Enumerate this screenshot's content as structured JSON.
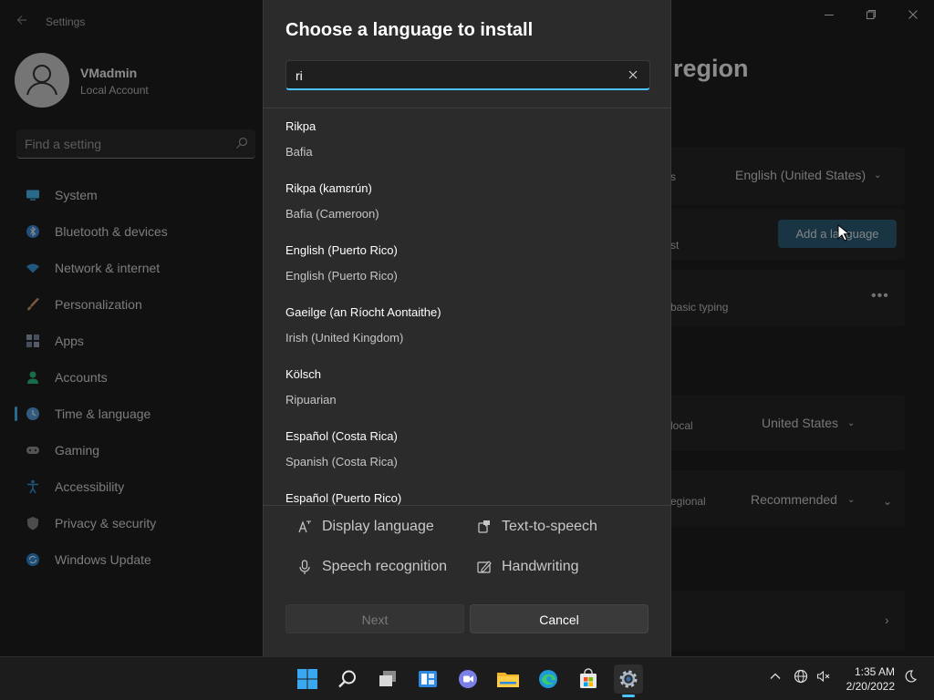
{
  "window": {
    "app_title": "Settings",
    "user": {
      "name": "VMadmin",
      "account_type": "Local Account"
    },
    "search": {
      "placeholder": "Find a setting"
    }
  },
  "sidebar": {
    "items": [
      {
        "label": "System",
        "icon": "monitor-icon",
        "color": "#4cc2ff"
      },
      {
        "label": "Bluetooth & devices",
        "icon": "bluetooth-icon",
        "color": "#3b8ee0"
      },
      {
        "label": "Network & internet",
        "icon": "wifi-icon",
        "color": "#3aa0e8"
      },
      {
        "label": "Personalization",
        "icon": "brush-icon",
        "color": "#e0a070"
      },
      {
        "label": "Apps",
        "icon": "apps-icon",
        "color": "#9aa8c0"
      },
      {
        "label": "Accounts",
        "icon": "person-icon",
        "color": "#2ec48a"
      },
      {
        "label": "Time & language",
        "icon": "clock-globe-icon",
        "color": "#5aa6e8",
        "active": true
      },
      {
        "label": "Gaming",
        "icon": "gamepad-icon",
        "color": "#9a9a9a"
      },
      {
        "label": "Accessibility",
        "icon": "accessibility-icon",
        "color": "#3a9ae0"
      },
      {
        "label": "Privacy & security",
        "icon": "shield-icon",
        "color": "#8a8a8a"
      },
      {
        "label": "Windows Update",
        "icon": "update-icon",
        "color": "#2e8ee0"
      }
    ]
  },
  "content": {
    "title": "region",
    "display_language_value": "English (United States)",
    "add_language_label": "Add a language",
    "basic_typing_text": "basic typing",
    "country_label": "local",
    "country_value": "United States",
    "regional_label": "egional",
    "regional_value": "Recommended",
    "row_text_s": "s",
    "row_text_st": "st"
  },
  "dialog": {
    "title": "Choose a language to install",
    "search_value": "ri",
    "languages": [
      {
        "native": "Rikpa",
        "english": "Bafia"
      },
      {
        "native": "Rikpa (kamɛrún)",
        "english": "Bafia (Cameroon)"
      },
      {
        "native": "English (Puerto Rico)",
        "english": "English (Puerto Rico)"
      },
      {
        "native": "Gaeilge (an Ríocht Aontaithe)",
        "english": "Irish (United Kingdom)"
      },
      {
        "native": "Kölsch",
        "english": "Ripuarian"
      },
      {
        "native": "Español (Costa Rica)",
        "english": "Spanish (Costa Rica)"
      },
      {
        "native": "Español (Puerto Rico)",
        "english": ""
      }
    ],
    "features": {
      "display_language": "Display language",
      "text_to_speech": "Text-to-speech",
      "speech_recognition": "Speech recognition",
      "handwriting": "Handwriting"
    },
    "next_label": "Next",
    "cancel_label": "Cancel"
  },
  "taskbar": {
    "time": "1:35 AM",
    "date": "2/20/2022",
    "accent": "#4cc2ff"
  }
}
